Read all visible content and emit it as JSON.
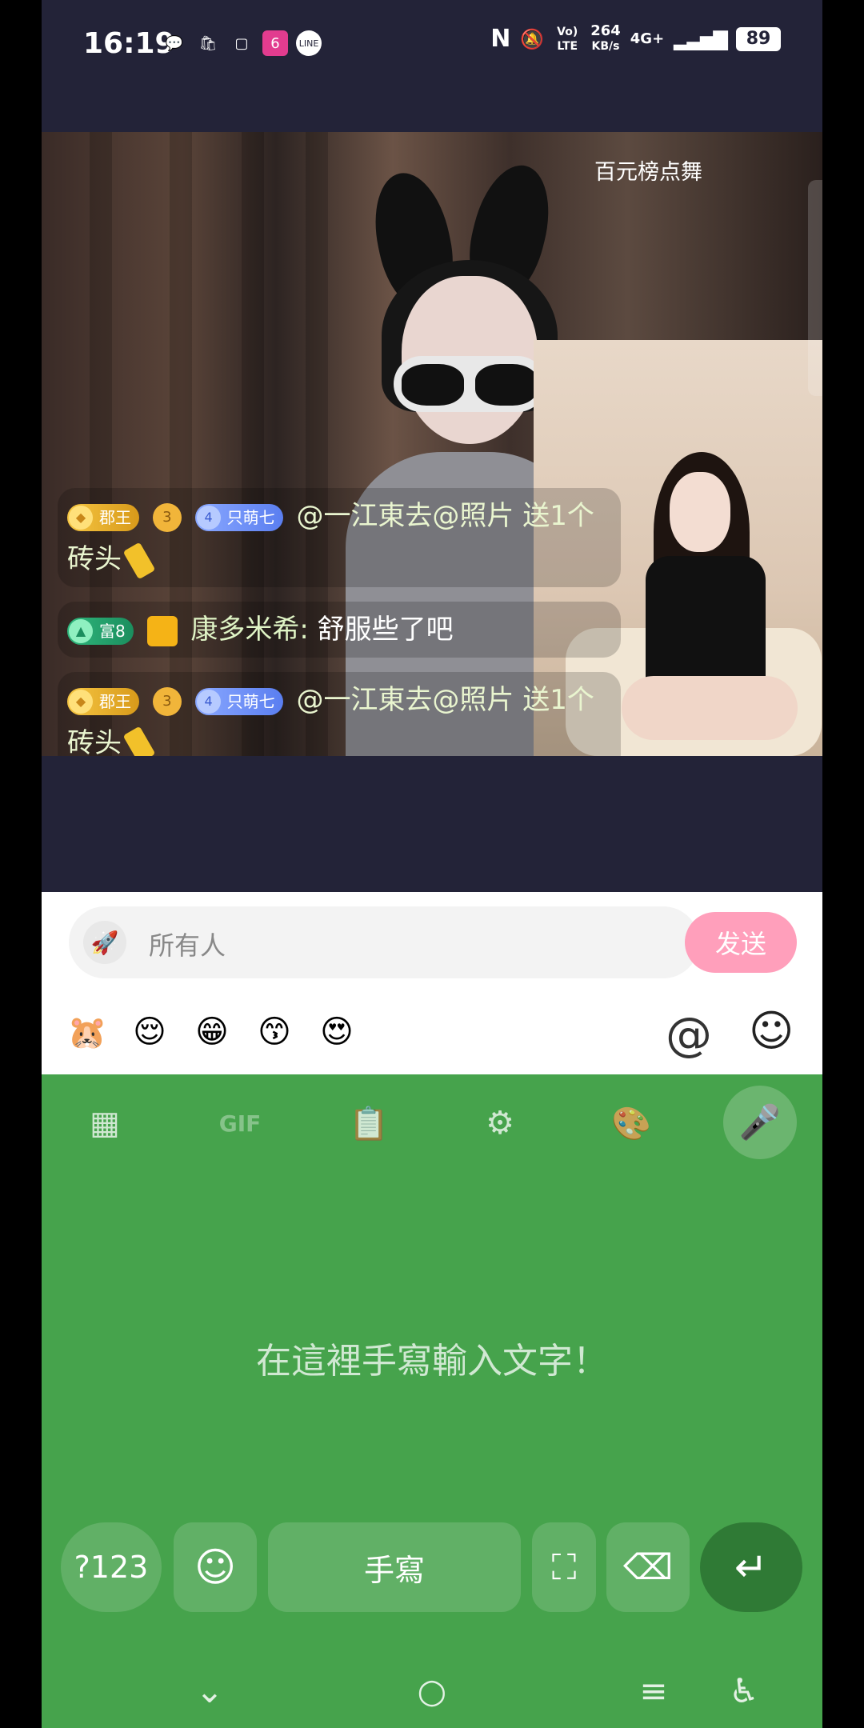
{
  "status_bar": {
    "time": "16:19",
    "net_speed_value": "264",
    "net_speed_unit": "KB/s",
    "network_type": "4G+",
    "volte": "Vo) LTE",
    "battery": "89"
  },
  "stream": {
    "banner_text": "百元榜点舞",
    "chat": [
      {
        "badge": "郡王",
        "level": "3",
        "fan_level": "4",
        "fan_badge": "只萌七",
        "text": "@一江東去@照片 送1个砖头"
      },
      {
        "badge": "富8",
        "username": "康多米希:",
        "text": "舒服些了吧"
      },
      {
        "badge": "郡王",
        "level": "3",
        "fan_level": "4",
        "fan_badge": "只萌七",
        "text": "@一江東去@照片 送1个砖头"
      }
    ]
  },
  "input": {
    "placeholder": "所有人",
    "send_label": "发送",
    "at_symbol": "@"
  },
  "emojis": [
    "🐹",
    "😌",
    "😁",
    "😙",
    "😍"
  ],
  "keyboard": {
    "gif_label": "GIF",
    "hint": "在這裡手寫輸入文字！",
    "num_key": "?123",
    "space_label": "手寫",
    "accent": "#46a34c",
    "enter_color": "#2f7a35"
  },
  "colors": {
    "send_button": "#ff9fbb",
    "app_bg": "#232338"
  }
}
